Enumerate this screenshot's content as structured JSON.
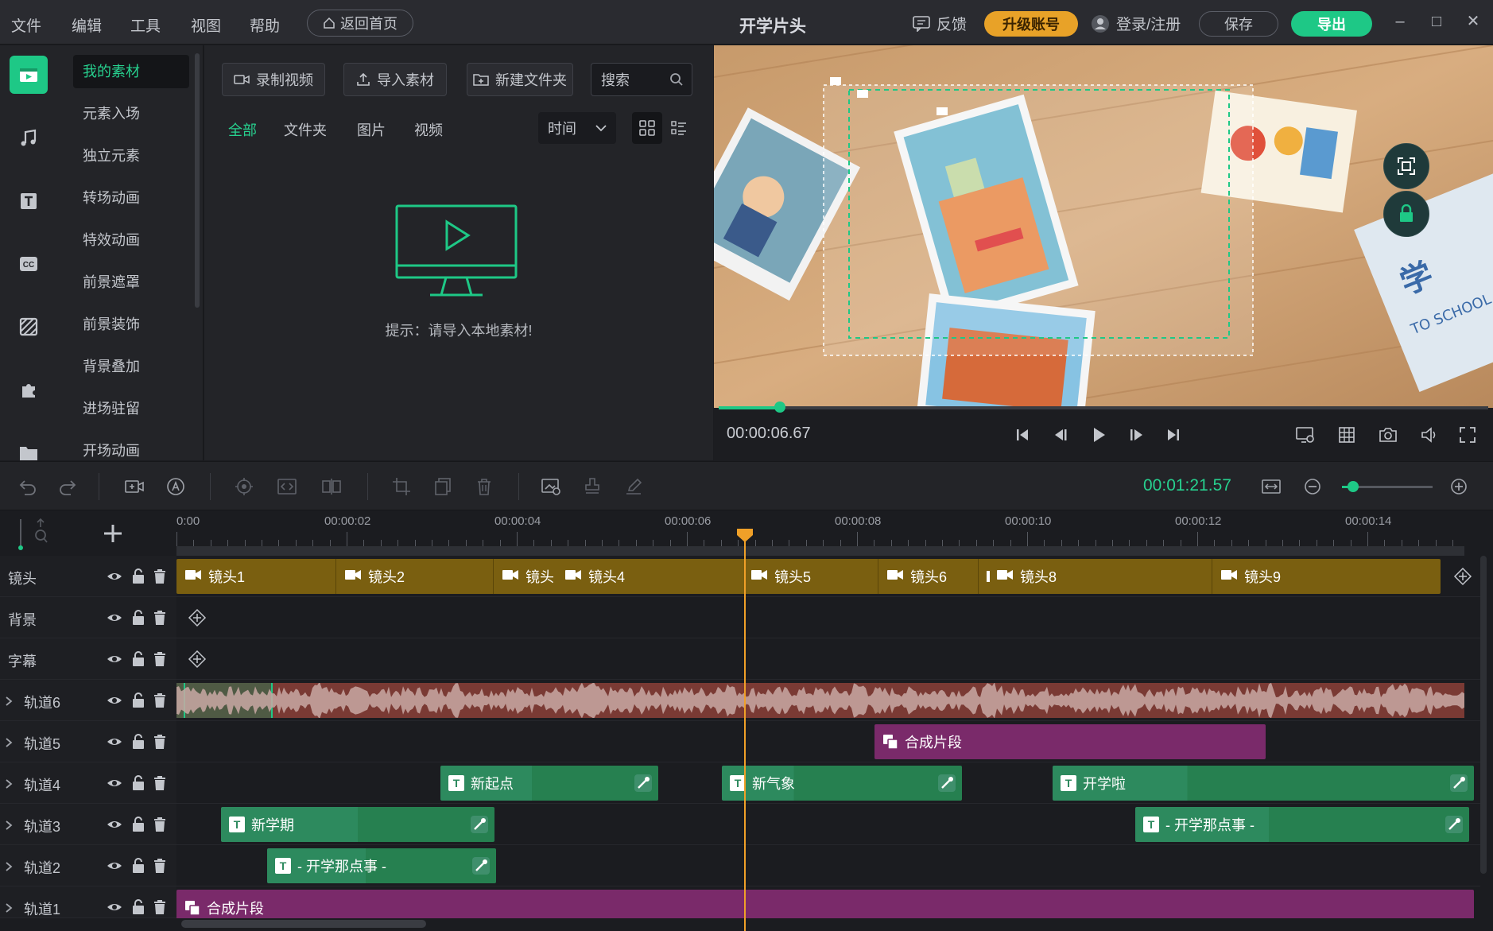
{
  "menu": [
    "文件",
    "编辑",
    "工具",
    "视图",
    "帮助"
  ],
  "home_button": "返回首页",
  "app_title": "开学片头",
  "feedback": "反馈",
  "upgrade": "升级账号",
  "login": "登录/注册",
  "save": "保存",
  "export": "导出",
  "categories": [
    "我的素材",
    "元素入场",
    "独立元素",
    "转场动画",
    "特效动画",
    "前景遮罩",
    "前景装饰",
    "背景叠加",
    "进场驻留",
    "开场动画"
  ],
  "media_buttons": {
    "record": "录制视频",
    "import": "导入素材",
    "new_folder": "新建文件夹"
  },
  "search_placeholder": "搜索",
  "filter_tabs": [
    "全部",
    "文件夹",
    "图片",
    "视频"
  ],
  "sort_label": "时间",
  "empty_hint": "提示：请导入本地素材!",
  "preview": {
    "timecode": "00:00:06.67",
    "progress": 0.08
  },
  "total_time": "00:01:21.57",
  "zoom": 0.12,
  "ruler_labels": [
    "0:00",
    "00:00:02",
    "00:00:04",
    "00:00:06",
    "00:00:08",
    "00:00:10",
    "00:00:12",
    "00:00:14"
  ],
  "tracks": {
    "shot": "镜头",
    "background": "背景",
    "subtitle": "字幕",
    "t6": "轨道6",
    "t5": "轨道5",
    "t4": "轨道4",
    "t3": "轨道3",
    "t2": "轨道2",
    "t1": "轨道1"
  },
  "shots": [
    "镜头1",
    "镜头2",
    "镜头",
    "镜头4",
    "镜头5",
    "镜头6",
    "镜头8",
    "镜头9"
  ],
  "clips": {
    "t5": "合成片段",
    "t4a": "新起点",
    "t4b": "新气象",
    "t4c": "开学啦",
    "t3a": "新学期",
    "t3b": "- 开学那点事 -",
    "t2a": "- 开学那点事 -",
    "t1": "合成片段"
  },
  "colors": {
    "accent": "#1ec886",
    "shot_track": "#7a5f10",
    "text_clip": "#2d8a5e",
    "composite_clip": "#7a2a6a",
    "audio_clip": "#7a3a34",
    "upgrade": "#e8a228",
    "playhead": "#f0a028"
  }
}
